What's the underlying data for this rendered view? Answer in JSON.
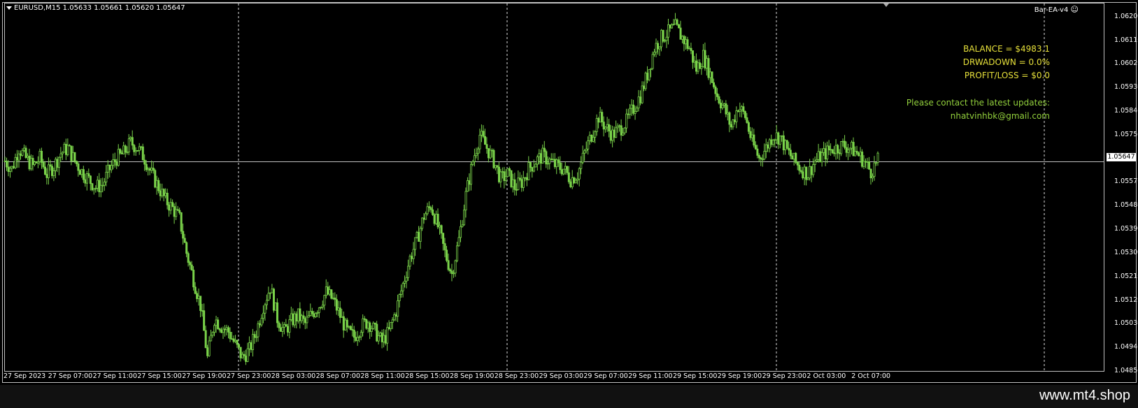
{
  "window": {
    "symbol_header": "EURUSD,M15  1.05633 1.05661 1.05620 1.05647",
    "ea_label": "Bar-EA-v4"
  },
  "overlay": {
    "balance": "BALANCE = $4983.1",
    "drawdown": "DRWADOWN = 0.0%",
    "profit_loss": "PROFIT/LOSS = $0.0",
    "contact_line": "Please contact the latest updates:",
    "contact_email": "nhatvinhbk@gmail.com"
  },
  "price_axis": [
    "1.06200",
    "1.06110",
    "1.06020",
    "1.05930",
    "1.05840",
    "1.05750",
    "1.05570",
    "1.05480",
    "1.05390",
    "1.05300",
    "1.05210",
    "1.05120",
    "1.05030",
    "1.04940",
    "1.04850"
  ],
  "current_price": "1.05647",
  "time_axis": [
    "27 Sep 2023",
    "27 Sep 07:00",
    "27 Sep 11:00",
    "27 Sep 15:00",
    "27 Sep 19:00",
    "27 Sep 23:00",
    "28 Sep 03:00",
    "28 Sep 07:00",
    "28 Sep 11:00",
    "28 Sep 15:00",
    "28 Sep 19:00",
    "28 Sep 23:00",
    "29 Sep 03:00",
    "29 Sep 07:00",
    "29 Sep 11:00",
    "29 Sep 15:00",
    "29 Sep 19:00",
    "29 Sep 23:00",
    "2 Oct 03:00",
    "2 Oct 07:00"
  ],
  "colors": {
    "candle": "#7ad34a",
    "background": "#000000",
    "grid": "#c0c0c0",
    "overlay_yellow": "#e6e03a",
    "overlay_green": "#92d03c"
  },
  "footer": {
    "watermark": "www.mt4.shop"
  },
  "chart_data": {
    "type": "line",
    "title": "EURUSD,M15",
    "ylim": [
      1.0485,
      1.0625
    ],
    "current": 1.05647,
    "series": [
      {
        "values": [
          1.0565,
          1.0562,
          1.057,
          1.0566,
          1.0563,
          1.0566,
          1.056,
          1.0563,
          1.0568,
          1.057,
          1.0565,
          1.0561,
          1.0558,
          1.0555,
          1.0556,
          1.0562,
          1.0566,
          1.0568,
          1.0572,
          1.057,
          1.0566,
          1.056,
          1.0555,
          1.055,
          1.0547,
          1.0543,
          1.053,
          1.052,
          1.051,
          1.049,
          1.0505,
          1.0502,
          1.05,
          1.0495,
          1.049,
          1.0493,
          1.05,
          1.051,
          1.0517,
          1.0505,
          1.05,
          1.0504,
          1.0506,
          1.0503,
          1.0507,
          1.051,
          1.0515,
          1.0512,
          1.0506,
          1.05,
          1.0498,
          1.0502,
          1.0504,
          1.05,
          1.0496,
          1.05,
          1.0508,
          1.0518,
          1.0528,
          1.0535,
          1.0544,
          1.0548,
          1.054,
          1.053,
          1.0522,
          1.0535,
          1.0552,
          1.0565,
          1.0575,
          1.057,
          1.0565,
          1.0558,
          1.056,
          1.0555,
          1.0557,
          1.0562,
          1.0565,
          1.0567,
          1.0565,
          1.0563,
          1.0562,
          1.0558,
          1.056,
          1.0568,
          1.0575,
          1.0582,
          1.0578,
          1.0575,
          1.0577,
          1.058,
          1.0585,
          1.059,
          1.0598,
          1.0608,
          1.0612,
          1.0614,
          1.0616,
          1.0612,
          1.0608,
          1.06,
          1.0605,
          1.0598,
          1.059,
          1.0585,
          1.0578,
          1.0586,
          1.0582,
          1.0572,
          1.0566,
          1.057,
          1.0575,
          1.0574,
          1.0569,
          1.0565,
          1.0562,
          1.056,
          1.0565,
          1.0567,
          1.0569,
          1.057,
          1.0571,
          1.057,
          1.0568,
          1.0565,
          1.0561,
          1.0565
        ]
      }
    ]
  }
}
